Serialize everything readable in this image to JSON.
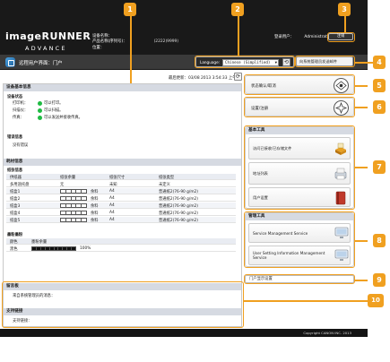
{
  "header": {
    "logo_line1": "imageRUNNER",
    "logo_line2": "ADVANCE",
    "device_name_label": "设备名称：",
    "product_name_label": "产品名称(序列号)：",
    "product_name_value": "(2222)9999)",
    "location_label": "位置：",
    "login_user_label": "登录用户：",
    "login_user_value": "Administrator",
    "logout_label": "注销"
  },
  "bar": {
    "title": "远程用户界面：门户",
    "language_label": "Language:",
    "language_value": "Chinese (Simplified)",
    "mail_button_label": "向系统管理员发送邮件"
  },
  "last_updated": "最后更新：03/08 2013 3:54:33 上午",
  "main": {
    "device_basic_info": {
      "title": "设备基本信息",
      "device_status_label": "设备状态",
      "status_rows": [
        {
          "label": "打印机：",
          "value": "可以打印。"
        },
        {
          "label": "扫描仪：",
          "value": "可以扫描。"
        },
        {
          "label": "传真：",
          "value": "可以发送并接收传真。"
        }
      ],
      "error_info_label": "错误信息",
      "error_info_value": "没有错误"
    },
    "consumables": {
      "title": "耗材信息",
      "paper_info_label": "纸张信息",
      "columns": [
        "供纸器",
        "纸张余量",
        "纸张尺寸",
        "纸张类型"
      ],
      "rows": [
        {
          "source": "多用途托盘",
          "remaining": "无",
          "size": "未知",
          "type": "未定义",
          "gauge": false
        },
        {
          "source": "纸盒1",
          "remaining": "余料",
          "size": "A4",
          "type": "普通纸2(76-90 g/m2)",
          "gauge": true
        },
        {
          "source": "纸盒2",
          "remaining": "余料",
          "size": "A4",
          "type": "普通纸2(76-90 g/m2)",
          "gauge": true
        },
        {
          "source": "纸盒3",
          "remaining": "余料",
          "size": "A4",
          "type": "普通纸2(76-90 g/m2)",
          "gauge": true
        },
        {
          "source": "纸盒4",
          "remaining": "余料",
          "size": "A4",
          "type": "普通纸2(76-90 g/m2)",
          "gauge": true
        },
        {
          "source": "纸盒5",
          "remaining": "余料",
          "size": "A4",
          "type": "普通纸2(76-90 g/m2)",
          "gauge": true
        }
      ],
      "toner_label": "墨粉墨粉",
      "toner_col_color": "颜色",
      "toner_col_level": "墨粉余量",
      "toner_row_color": "黑色",
      "toner_level_text": "100%",
      "toner_level": 1.0
    },
    "message_board": {
      "title": "留言板",
      "text": "来自系统管理员的消息："
    },
    "support_link": {
      "title": "支持链接",
      "text": "支持链接："
    }
  },
  "right": {
    "status_check_label": "状态确认/取消",
    "settings_label": "设置/注册",
    "basic_tools_title": "基本工具",
    "basic_tools": [
      {
        "label": "访问已接收/已存储文件"
      },
      {
        "label": "地址列表"
      },
      {
        "label": "用户设置"
      }
    ],
    "admin_tools_title": "管理工具",
    "admin_tools": [
      {
        "label": "Service Management Service"
      },
      {
        "label": "User Setting Information Management Service"
      }
    ],
    "portal_display_label": "门户显示设置"
  },
  "footer": {
    "copyright": "Copyright CANON INC. 2013"
  },
  "callouts": [
    "1",
    "2",
    "3",
    "4",
    "5",
    "6",
    "7",
    "8",
    "9",
    "10"
  ],
  "colors": {
    "callout": "#f0a020",
    "header_bg": "#191919",
    "status_ok": "#1fbb43",
    "section_head": "#d6dae2"
  }
}
